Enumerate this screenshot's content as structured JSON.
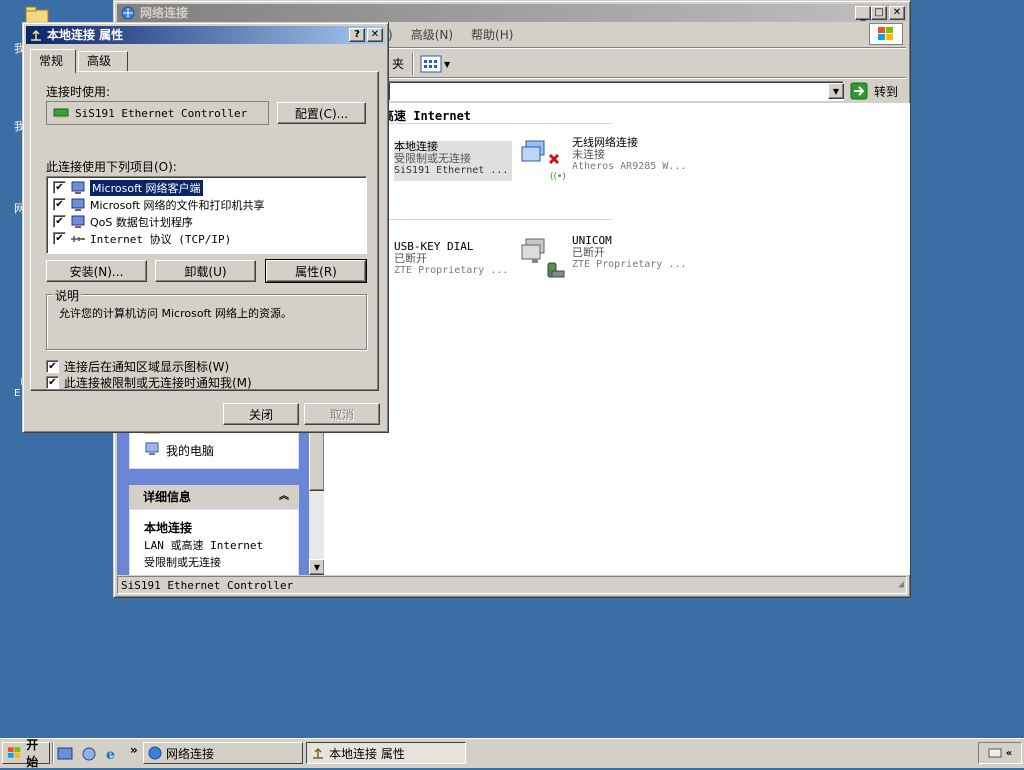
{
  "desktop": {
    "icons": [
      {
        "label": "我"
      },
      {
        "label": "我"
      },
      {
        "label": "网"
      },
      {
        "label": "I\nE"
      }
    ]
  },
  "netwin": {
    "title": "网络连接",
    "menu": [
      "(T)",
      "高级(N)",
      "帮助(H)"
    ],
    "toolbar_partial": "夹",
    "go_label": "转到",
    "group_header": "高速 Internet",
    "connections": [
      {
        "name": "本地连接",
        "status": "受限制或无连接",
        "device": "SiS191 Ethernet ..."
      },
      {
        "name": "无线网络连接",
        "status": "未连接",
        "device": "Atheros AR9285 W..."
      },
      {
        "name": "USB-KEY DIAL",
        "status": "已断开",
        "device": "ZTE Proprietary ..."
      },
      {
        "name": "UNICOM",
        "status": "已断开",
        "device": "ZTE Proprietary ..."
      }
    ],
    "taskpane": {
      "other_places_item": "我的电脑",
      "details_title": "详细信息",
      "details_name": "本地连接",
      "details_line1": "LAN 或高速 Internet",
      "details_line2": "受限制或无连接"
    },
    "status_text": "SiS191 Ethernet Controller"
  },
  "dialog": {
    "title": "本地连接 属性",
    "tabs": [
      "常规",
      "高级"
    ],
    "connect_using_label": "连接时使用:",
    "adapter_name": "SiS191 Ethernet Controller",
    "configure_button": "配置(C)...",
    "items_label": "此连接使用下列项目(O):",
    "components": [
      {
        "label": "Microsoft 网络客户端",
        "checked": true
      },
      {
        "label": "Microsoft 网络的文件和打印机共享",
        "checked": true
      },
      {
        "label": "QoS 数据包计划程序",
        "checked": true
      },
      {
        "label": "Internet 协议 (TCP/IP)",
        "checked": true
      }
    ],
    "install_button": "安装(N)...",
    "uninstall_button": "卸载(U)",
    "properties_button": "属性(R)",
    "description_title": "说明",
    "description_text": "允许您的计算机访问 Microsoft 网络上的资源。",
    "option1": "连接后在通知区域显示图标(W)",
    "option2": "此连接被限制或无连接时通知我(M)",
    "close_button": "关闭",
    "cancel_button": "取消"
  },
  "taskbar": {
    "start_label": "开始",
    "chevron": "»",
    "tasks": [
      {
        "label": "网络连接"
      },
      {
        "label": "本地连接 属性"
      }
    ]
  },
  "colors": {
    "desktop": "#3a6ea5",
    "title_active": "#0a246a",
    "face": "#d4d0c8",
    "selection": "#0a246a"
  }
}
